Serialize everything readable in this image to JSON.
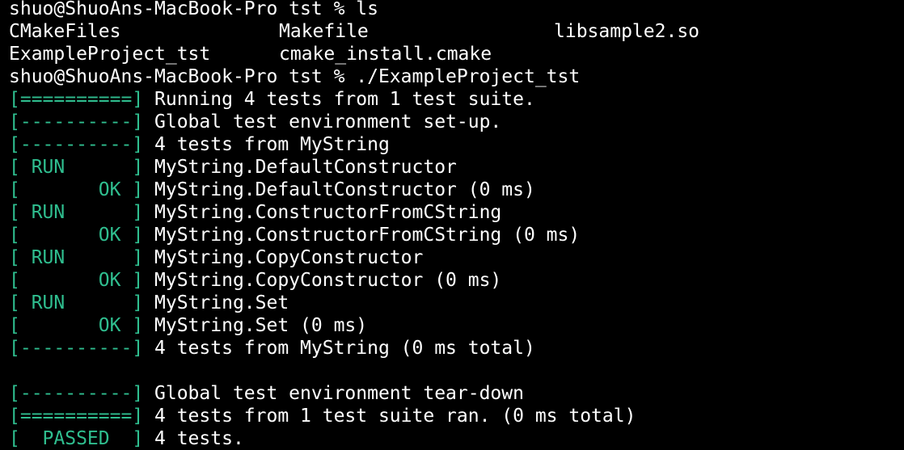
{
  "colors": {
    "background": "#000000",
    "text": "#ffffff",
    "status_tag": "#2fbe8f"
  },
  "lines": [
    {
      "kind": "prompt",
      "text": "shuo@ShuoAns-MacBook-Pro tst % ls"
    },
    {
      "kind": "ls",
      "cols": [
        "CMakeFiles",
        "Makefile",
        "libsample2.so"
      ]
    },
    {
      "kind": "ls",
      "cols": [
        "ExampleProject_tst",
        "cmake_install.cmake"
      ]
    },
    {
      "kind": "prompt",
      "text": "shuo@ShuoAns-MacBook-Pro tst % ./ExampleProject_tst"
    },
    {
      "kind": "test",
      "tag": "[==========]",
      "msg": " Running 4 tests from 1 test suite."
    },
    {
      "kind": "test",
      "tag": "[----------]",
      "msg": " Global test environment set-up."
    },
    {
      "kind": "test",
      "tag": "[----------]",
      "msg": " 4 tests from MyString"
    },
    {
      "kind": "test",
      "tag": "[ RUN      ]",
      "msg": " MyString.DefaultConstructor"
    },
    {
      "kind": "test",
      "tag": "[       OK ]",
      "msg": " MyString.DefaultConstructor (0 ms)"
    },
    {
      "kind": "test",
      "tag": "[ RUN      ]",
      "msg": " MyString.ConstructorFromCString"
    },
    {
      "kind": "test",
      "tag": "[       OK ]",
      "msg": " MyString.ConstructorFromCString (0 ms)"
    },
    {
      "kind": "test",
      "tag": "[ RUN      ]",
      "msg": " MyString.CopyConstructor"
    },
    {
      "kind": "test",
      "tag": "[       OK ]",
      "msg": " MyString.CopyConstructor (0 ms)"
    },
    {
      "kind": "test",
      "tag": "[ RUN      ]",
      "msg": " MyString.Set"
    },
    {
      "kind": "test",
      "tag": "[       OK ]",
      "msg": " MyString.Set (0 ms)"
    },
    {
      "kind": "test",
      "tag": "[----------]",
      "msg": " 4 tests from MyString (0 ms total)"
    },
    {
      "kind": "blank"
    },
    {
      "kind": "test",
      "tag": "[----------]",
      "msg": " Global test environment tear-down"
    },
    {
      "kind": "test",
      "tag": "[==========]",
      "msg": " 4 tests from 1 test suite ran. (0 ms total)"
    },
    {
      "kind": "test",
      "tag": "[  PASSED  ]",
      "msg": " 4 tests."
    }
  ]
}
